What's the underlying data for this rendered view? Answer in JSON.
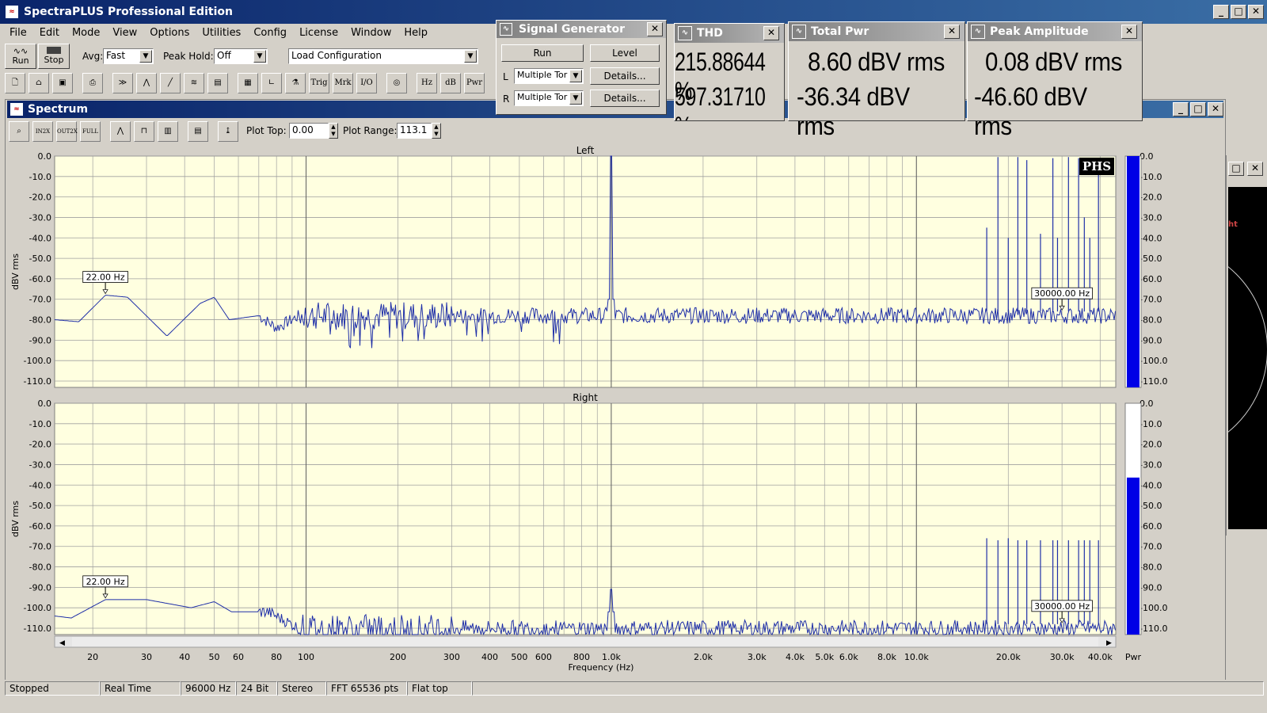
{
  "app": {
    "title": "SpectraPLUS Professional Edition"
  },
  "menu": [
    "File",
    "Edit",
    "Mode",
    "View",
    "Options",
    "Utilities",
    "Config",
    "License",
    "Window",
    "Help"
  ],
  "toolbar": {
    "run": "Run",
    "stop": "Stop",
    "avg_label": "Avg:",
    "avg_value": "Fast",
    "peakhold_label": "Peak Hold:",
    "peakhold_value": "Off",
    "config_value": "Load Configuration",
    "icons": [
      "Trig",
      "Mrk",
      "I/O"
    ],
    "unit_btns": [
      "Hz",
      "dB",
      "Pwr"
    ]
  },
  "siggen": {
    "title": "Signal Generator",
    "run": "Run",
    "level": "Level",
    "l": "L",
    "r": "R",
    "l_value": "Multiple Tor",
    "r_value": "Multiple Tor",
    "details": "Details..."
  },
  "meters": {
    "thd": {
      "title": "THD",
      "v1": "215.88644 %",
      "v2": "597.31710 %"
    },
    "pwr": {
      "title": "Total Pwr",
      "v1": "8.60 dBV rms",
      "v2": "-36.34 dBV rms"
    },
    "peak": {
      "title": "Peak Amplitude",
      "v1": "0.08 dBV rms",
      "v2": "-46.60 dBV rms"
    }
  },
  "spectrum": {
    "title": "Spectrum",
    "plot_top_label": "Plot Top:",
    "plot_top": "0.00",
    "plot_range_label": "Plot Range:",
    "plot_range": "113.1",
    "left_label": "Left",
    "right_label": "Right",
    "ylabel": "dBV rms",
    "xlabel": "Frequency (Hz)",
    "badge": "PHS",
    "pwr_label": "Pwr",
    "marker_low": "22.00 Hz",
    "marker_high": "30000.00 Hz"
  },
  "chart_data": {
    "type": "line",
    "xscale": "log",
    "xlim": [
      15,
      45000
    ],
    "ylim": [
      -113.1,
      0
    ],
    "xticks": [
      {
        "v": 20,
        "t": "20"
      },
      {
        "v": 30,
        "t": "30"
      },
      {
        "v": 40,
        "t": "40"
      },
      {
        "v": 50,
        "t": "50"
      },
      {
        "v": 60,
        "t": "60"
      },
      {
        "v": 80,
        "t": "80"
      },
      {
        "v": 100,
        "t": "100"
      },
      {
        "v": 200,
        "t": "200"
      },
      {
        "v": 300,
        "t": "300"
      },
      {
        "v": 400,
        "t": "400"
      },
      {
        "v": 500,
        "t": "500"
      },
      {
        "v": 600,
        "t": "600"
      },
      {
        "v": 800,
        "t": "800"
      },
      {
        "v": 1000,
        "t": "1.0k"
      },
      {
        "v": 2000,
        "t": "2.0k"
      },
      {
        "v": 3000,
        "t": "3.0k"
      },
      {
        "v": 4000,
        "t": "4.0k"
      },
      {
        "v": 5000,
        "t": "5.0k"
      },
      {
        "v": 6000,
        "t": "6.0k"
      },
      {
        "v": 8000,
        "t": "8.0k"
      },
      {
        "v": 10000,
        "t": "10.0k"
      },
      {
        "v": 20000,
        "t": "20.0k"
      },
      {
        "v": 30000,
        "t": "30.0k"
      },
      {
        "v": 40000,
        "t": "40.0k"
      }
    ],
    "yticks": [
      "0.0",
      "-10.0",
      "-20.0",
      "-30.0",
      "-40.0",
      "-50.0",
      "-60.0",
      "-70.0",
      "-80.0",
      "-90.0",
      "-100.0",
      "-110.0"
    ],
    "series": [
      {
        "name": "Left",
        "floor": -78,
        "peak": [
          1000,
          0
        ],
        "lowfreq": [
          [
            15,
            -80
          ],
          [
            18,
            -81
          ],
          [
            22,
            -68
          ],
          [
            26,
            -69
          ],
          [
            35,
            -88
          ],
          [
            45,
            -72
          ],
          [
            50,
            -69
          ],
          [
            56,
            -80
          ],
          [
            70,
            -78
          ],
          [
            80,
            -84
          ],
          [
            95,
            -78
          ]
        ],
        "spikes": [
          [
            17000,
            -35
          ],
          [
            18500,
            -0.5
          ],
          [
            20000,
            -40
          ],
          [
            21500,
            -0.5
          ],
          [
            23000,
            -2
          ],
          [
            25500,
            -38
          ],
          [
            28000,
            -1
          ],
          [
            29000,
            -40
          ],
          [
            31500,
            -0.5
          ],
          [
            34000,
            -1
          ],
          [
            35500,
            -30
          ],
          [
            37000,
            -40
          ],
          [
            39500,
            -1
          ]
        ]
      },
      {
        "name": "Right",
        "floor": -110,
        "peak": [
          1000,
          -91
        ],
        "lowfreq": [
          [
            15,
            -104
          ],
          [
            17,
            -105
          ],
          [
            22,
            -96
          ],
          [
            30,
            -96
          ],
          [
            42,
            -100
          ],
          [
            50,
            -97
          ],
          [
            57,
            -102
          ],
          [
            75,
            -102
          ],
          [
            95,
            -110
          ]
        ],
        "spikes": [
          [
            17000,
            -66
          ],
          [
            18500,
            -67
          ],
          [
            20000,
            -66
          ],
          [
            21500,
            -67
          ],
          [
            23000,
            -67
          ],
          [
            25500,
            -67
          ],
          [
            28000,
            -67
          ],
          [
            29000,
            -67
          ],
          [
            31500,
            -67
          ],
          [
            34000,
            -67
          ],
          [
            35500,
            -67
          ],
          [
            37000,
            -67
          ],
          [
            39500,
            -67
          ]
        ]
      }
    ],
    "pwr_level_left": 0.0,
    "pwr_level_right": -36.34
  },
  "status": [
    "Stopped",
    "Real Time",
    "96000 Hz",
    "24 Bit",
    "Stereo",
    "FFT 65536 pts",
    "Flat top"
  ]
}
